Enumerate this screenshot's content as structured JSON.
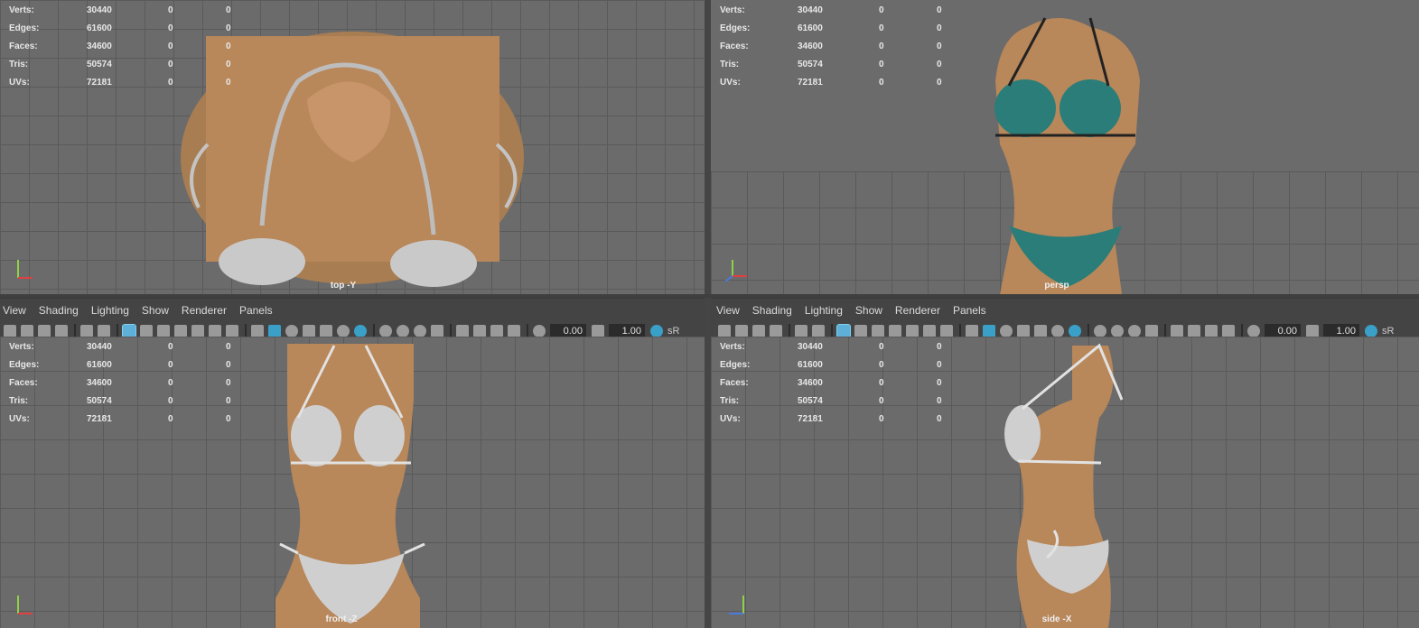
{
  "stats": [
    {
      "label": "Verts:",
      "value": "30440",
      "a": "0",
      "b": "0"
    },
    {
      "label": "Edges:",
      "value": "61600",
      "a": "0",
      "b": "0"
    },
    {
      "label": "Faces:",
      "value": "34600",
      "a": "0",
      "b": "0"
    },
    {
      "label": "Tris:",
      "value": "50574",
      "a": "0",
      "b": "0"
    },
    {
      "label": "UVs:",
      "value": "72181",
      "a": "0",
      "b": "0"
    }
  ],
  "viewports": {
    "top": {
      "camera": "top -Y"
    },
    "persp": {
      "camera": "persp"
    },
    "front": {
      "camera": "front -Z"
    },
    "side": {
      "camera": "side -X"
    }
  },
  "panel_menu": [
    "View",
    "Shading",
    "Lighting",
    "Show",
    "Renderer",
    "Panels"
  ],
  "toolbar": {
    "exposure": "0.00",
    "gamma": "1.00",
    "color_space": "sR"
  },
  "axes": {
    "x": "x",
    "y": "y",
    "z": "z"
  },
  "colors": {
    "viewport_bg": "#6b6b6b",
    "skin": "#b8875a",
    "bikini_teal": "#2a7d78",
    "bikini_gray": "#cfcfcf",
    "accent": "#3aa0c8"
  }
}
